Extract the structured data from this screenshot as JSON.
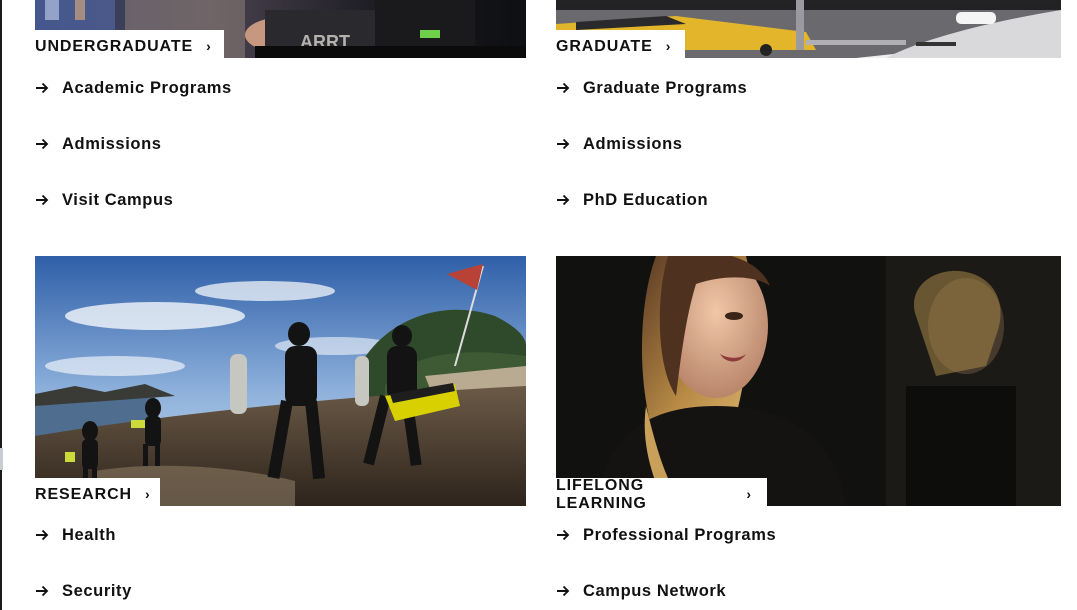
{
  "cards": [
    {
      "title": "UNDERGRADUATE",
      "photo": "students-laptop-photo",
      "links": [
        "Academic Programs",
        "Admissions",
        "Visit Campus"
      ]
    },
    {
      "title": "GRADUATE",
      "photo": "lab-vehicle-photo",
      "links": [
        "Graduate Programs",
        "Admissions",
        "PhD Education"
      ]
    },
    {
      "title": "RESEARCH",
      "photo": "scuba-divers-beach-photo",
      "links": [
        "Health",
        "Security"
      ]
    },
    {
      "title": "LIFELONG LEARNING",
      "photo": "woman-portrait-photo",
      "links": [
        "Professional Programs",
        "Campus Network"
      ]
    }
  ],
  "icons": {
    "link_arrow": "arrow-right-icon",
    "label_chevron": "chevron-right-icon"
  },
  "label_chevron_glyph": "›",
  "colors": {
    "text": "#111111",
    "background": "#ffffff"
  }
}
